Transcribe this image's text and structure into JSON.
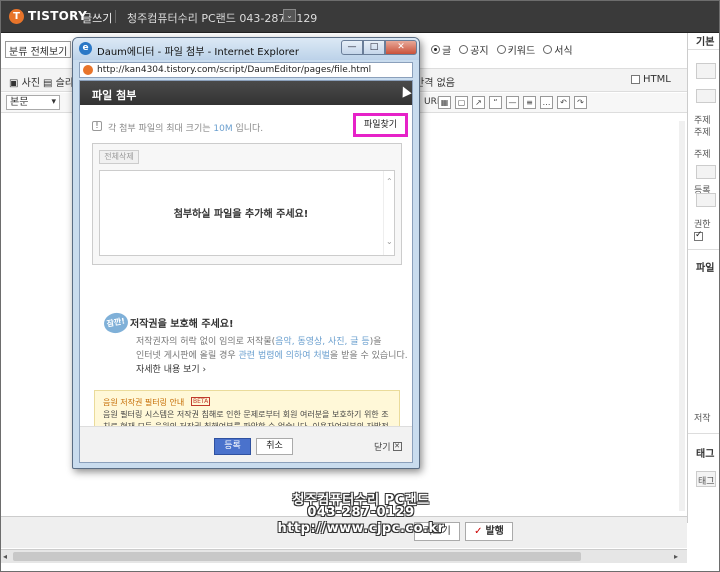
{
  "header": {
    "logo_mark": "T",
    "logo_text": "TISTORY",
    "write_label": "글쓰기",
    "blog_title": "청주컴퓨터수리 PC랜드 043-287-0129",
    "blog_dropdown_glyph": "⌄"
  },
  "editor": {
    "category_value": "분류 전체보기",
    "radios": [
      {
        "label": "글",
        "selected": true
      },
      {
        "label": "공지",
        "selected": false
      },
      {
        "label": "키워드",
        "selected": false
      },
      {
        "label": "서식",
        "selected": false
      }
    ],
    "toolbar": {
      "photo_label": "사진",
      "slide_label": "슬라",
      "gap_label": "간격 없음",
      "html_label": "HTML",
      "format_value": "본문",
      "url_label": "URL"
    }
  },
  "sidebar": {
    "title": "기본",
    "texts": [
      "주제",
      "주제",
      "주제",
      "등록",
      "권한",
      "파일",
      "저작",
      "태그",
      "태그"
    ],
    "checked": true
  },
  "bottom": {
    "preview_label": "리보기",
    "publish_label": "발행",
    "publish_check": "✓"
  },
  "watermark": {
    "line1": "청주컴퓨터수리 PC랜드",
    "line2": "043-287-0129",
    "line3": "http://www.cjpc.co.kr"
  },
  "popup": {
    "window_title": "Daum에디터 - 파일 첨부 - Internet Explorer",
    "address": "http://kan4304.tistory.com/script/DaumEditor/pages/file.html",
    "ctrl_min": "—",
    "ctrl_max": "□",
    "ctrl_close": "✕",
    "header_title": "파일 첨부",
    "info_prefix": "각 첨부 파일의 최대 크기는 ",
    "info_size": "10M",
    "info_suffix": " 입니다.",
    "find_button": "파일찾기",
    "delete_all": "전체삭제",
    "empty_message": "첨부하실 파일을 추가해 주세요!",
    "copyright": {
      "badge": "잠깐!",
      "title": "저작권을 보호해 주세요!",
      "desc1_a": "저작권자의 허락 없이 임의로 저작물(",
      "desc1_hl": "음악, 동영상, 사진, 글 등",
      "desc1_b": ")을",
      "desc2_a": "인터넷 게시판에 올릴 경우 ",
      "desc2_hl": "관련 법령에 의하여 처벌",
      "desc2_b": "을 받을 수 있습니다.",
      "more": "자세한 내용 보기 ›"
    },
    "notice": {
      "title": "음원 저작권 필터링 안내",
      "beta": "BETA",
      "body": "음원 필터링 시스템은 저작권 침해로 인한 문제로부터 회원 여러분을 보호하기 위한 조치로 현재 모든 음원의 저작권 침해여부를 파악할 수 없습니다. 이용자여러분의 자발적인 주의와 참여가 필요합니다."
    },
    "footer": {
      "register": "등록",
      "cancel": "취소",
      "close": "닫기",
      "close_glyph": "✕"
    }
  }
}
